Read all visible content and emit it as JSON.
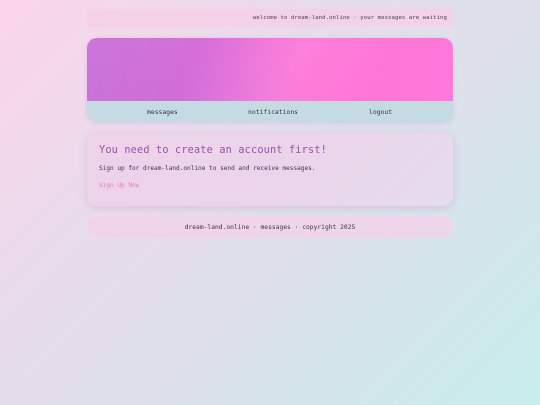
{
  "topbar": {
    "message": "welcome to dream-land.online · your messages are waiting"
  },
  "nav": {
    "items": [
      {
        "label": "messages"
      },
      {
        "label": "notifications"
      },
      {
        "label": "logout"
      }
    ]
  },
  "notice": {
    "title": "You need to create an account first!",
    "text": "Sign up for dream-land.online to send and receive messages.",
    "link_label": "Sign Up Now"
  },
  "footer": {
    "text": "dream-land.online · messages · copyright 2025"
  },
  "colors": {
    "accent": "#9c4fab",
    "link": "#ea78c4",
    "banner_start": "#c66ad6",
    "banner_end": "#ff78da",
    "nav_bg": "#c4dbe3"
  }
}
